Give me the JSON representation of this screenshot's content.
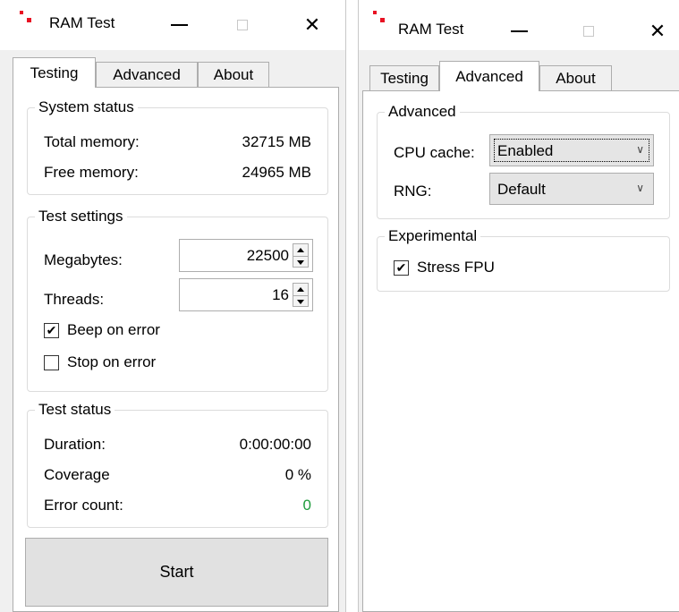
{
  "left_window": {
    "title": "RAM Test",
    "tabs": [
      {
        "label": "Testing",
        "active": true
      },
      {
        "label": "Advanced",
        "active": false
      },
      {
        "label": "About",
        "active": false
      }
    ],
    "system_status": {
      "legend": "System status",
      "total_memory_label": "Total memory:",
      "total_memory_value": "32715 MB",
      "free_memory_label": "Free memory:",
      "free_memory_value": "24965 MB"
    },
    "test_settings": {
      "legend": "Test settings",
      "megabytes_label": "Megabytes:",
      "megabytes_value": "22500",
      "threads_label": "Threads:",
      "threads_value": "16",
      "beep_on_error_label": "Beep on error",
      "beep_on_error_checked": true,
      "stop_on_error_label": "Stop on error",
      "stop_on_error_checked": false
    },
    "test_status": {
      "legend": "Test status",
      "duration_label": "Duration:",
      "duration_value": "0:00:00:00",
      "coverage_label": "Coverage",
      "coverage_value": "0 %",
      "error_count_label": "Error count:",
      "error_count_value": "0"
    },
    "start_label": "Start"
  },
  "right_window": {
    "title": "RAM Test",
    "tabs": [
      {
        "label": "Testing",
        "active": false
      },
      {
        "label": "Advanced",
        "active": true
      },
      {
        "label": "About",
        "active": false
      }
    ],
    "advanced": {
      "legend": "Advanced",
      "cpu_cache_label": "CPU cache:",
      "cpu_cache_value": "Enabled",
      "rng_label": "RNG:",
      "rng_value": "Default"
    },
    "experimental": {
      "legend": "Experimental",
      "stress_fpu_label": "Stress FPU",
      "stress_fpu_checked": true
    }
  },
  "colors": {
    "accent_red": "#e81123",
    "error_count_green": "#1e9c3c"
  }
}
